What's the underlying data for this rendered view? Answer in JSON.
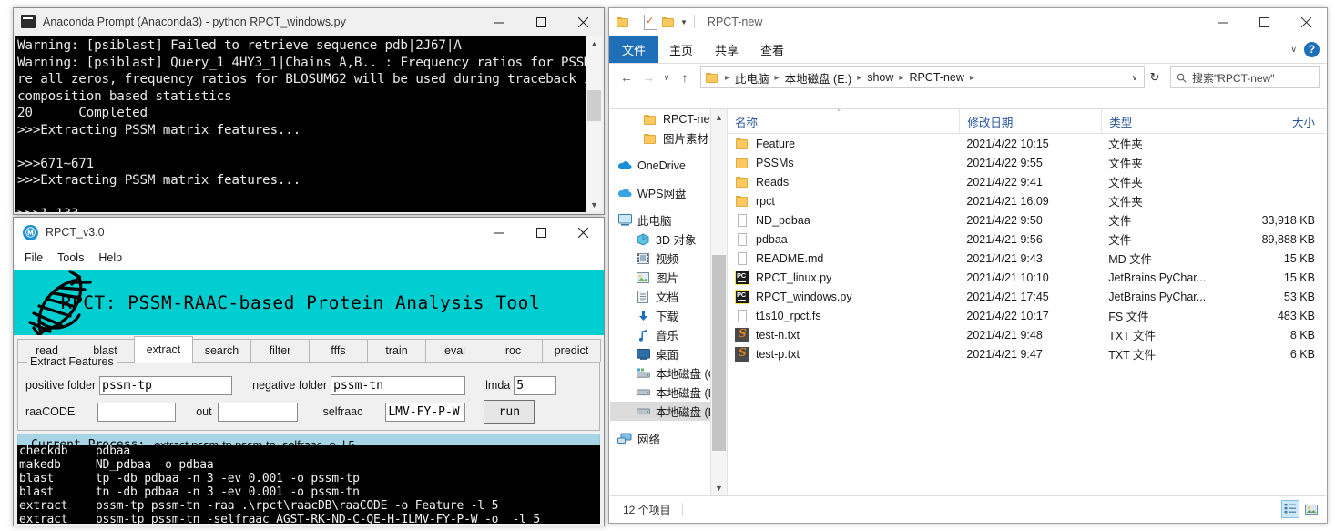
{
  "console_window": {
    "title": "Anaconda Prompt (Anaconda3) - python  RPCT_windows.py",
    "icon": "cmd-icon",
    "buttons": {
      "minimize": "─",
      "maximize": "☐",
      "close": "✕"
    },
    "text": "Warning: [psiblast] Failed to retrieve sequence pdb|2J67|A\nWarning: [psiblast] Query_1 4HY3_1|Chains A,B.. : Frequency ratios for PSSM a\nre all zeros, frequency ratios for BLOSUM62 will be used during traceback in\ncomposition based statistics\n20      Completed\n>>>Extracting PSSM matrix features...\n\n>>>671~671\n>>>Extracting PSSM matrix features...\n\n>>>1~133"
  },
  "rpct_window": {
    "title": "RPCT_v3.0",
    "icon": "rpct-logo-icon",
    "buttons": {
      "minimize": "─",
      "maximize": "☐",
      "close": "✕"
    },
    "menu": [
      "File",
      "Tools",
      "Help"
    ],
    "banner": {
      "title": "RPCT: PSSM-RAAC-based Protein Analysis Tool",
      "color": "#00ced1",
      "logo": "dna-helix-icon"
    },
    "tabs": [
      {
        "label": "read",
        "active": false
      },
      {
        "label": "blast",
        "active": false
      },
      {
        "label": "extract",
        "active": true
      },
      {
        "label": "search",
        "active": false
      },
      {
        "label": "filter",
        "active": false
      },
      {
        "label": "fffs",
        "active": false
      },
      {
        "label": "train",
        "active": false
      },
      {
        "label": "eval",
        "active": false
      },
      {
        "label": "roc",
        "active": false
      },
      {
        "label": "predict",
        "active": false
      }
    ],
    "panel": {
      "legend": "Extract Features",
      "fields": {
        "positive_folder_label": "positive folder",
        "positive_folder_value": "pssm-tp",
        "negative_folder_label": "negative folder",
        "negative_folder_value": "pssm-tn",
        "lmda_label": "lmda",
        "lmda_value": "5",
        "raacode_label": "raaCODE",
        "raacode_value": "",
        "out_label": "out",
        "out_value": "",
        "selfraac_label": "selfraac",
        "selfraac_value": "LMV-FY-P-W"
      },
      "run_button": "run"
    },
    "process_bar": {
      "label": "Current Process:",
      "command": "extract  pssm-tp pssm-tn -selfraac  -o  -l 5",
      "color": "#a8d5e5"
    },
    "console_text": "checkdb    pdbaa\nmakedb     ND_pdbaa -o pdbaa\nblast      tp -db pdbaa -n 3 -ev 0.001 -o pssm-tp\nblast      tn -db pdbaa -n 3 -ev 0.001 -o pssm-tn\nextract    pssm-tp pssm-tn -raa .\\rpct\\raacDB\\raaCODE -o Feature -l 5\nextract    pssm-tp pssm-tn -selfraac AGST-RK-ND-C-QE-H-ILMV-FY-P-W -o  -l 5"
  },
  "explorer_window": {
    "title": "RPCT-new",
    "quick_access": [
      "folder-icon",
      "properties-icon",
      "new-folder-icon",
      "customize-caret-icon"
    ],
    "buttons": {
      "minimize": "─",
      "maximize": "☐",
      "close": "✕"
    },
    "ribbon_tabs": [
      {
        "label": "文件",
        "active": true
      },
      {
        "label": "主页",
        "active": false
      },
      {
        "label": "共享",
        "active": false
      },
      {
        "label": "查看",
        "active": false
      }
    ],
    "ribbon_right": {
      "caret": "∨",
      "help": "?"
    },
    "nav": {
      "back": "←",
      "forward": "→",
      "recent": "∨",
      "up": "↑",
      "breadcrumb": [
        "此电脑",
        "本地磁盘 (E:)",
        "show",
        "RPCT-new"
      ],
      "address_caret": "∨",
      "refresh": "↻",
      "search_placeholder": "搜索\"RPCT-new\"",
      "search_icon": "search-icon"
    },
    "sidebar": [
      {
        "label": "RPCT-new",
        "icon": "folder-icon",
        "indent": 1,
        "selected": false
      },
      {
        "label": "图片素材",
        "icon": "folder-icon",
        "indent": 1,
        "selected": false
      },
      {
        "label": "OneDrive",
        "icon": "onedrive-icon",
        "indent": 0,
        "selected": false,
        "gap_before": true
      },
      {
        "label": "WPS网盘",
        "icon": "wps-cloud-icon",
        "indent": 0,
        "selected": false,
        "gap_before": true
      },
      {
        "label": "此电脑",
        "icon": "this-pc-icon",
        "indent": 0,
        "selected": false,
        "gap_before": true
      },
      {
        "label": "3D 对象",
        "icon": "3d-objects-icon",
        "indent": 1,
        "selected": false
      },
      {
        "label": "视频",
        "icon": "videos-icon",
        "indent": 1,
        "selected": false
      },
      {
        "label": "图片",
        "icon": "pictures-icon",
        "indent": 1,
        "selected": false
      },
      {
        "label": "文档",
        "icon": "documents-icon",
        "indent": 1,
        "selected": false
      },
      {
        "label": "下载",
        "icon": "downloads-icon",
        "indent": 1,
        "selected": false
      },
      {
        "label": "音乐",
        "icon": "music-icon",
        "indent": 1,
        "selected": false
      },
      {
        "label": "桌面",
        "icon": "desktop-icon",
        "indent": 1,
        "selected": false
      },
      {
        "label": "本地磁盘 (C:)",
        "icon": "system-drive-icon",
        "indent": 1,
        "selected": false
      },
      {
        "label": "本地磁盘 (D:)",
        "icon": "drive-icon",
        "indent": 1,
        "selected": false
      },
      {
        "label": "本地磁盘 (E:)",
        "icon": "drive-icon",
        "indent": 1,
        "selected": true
      },
      {
        "label": "网络",
        "icon": "network-icon",
        "indent": 0,
        "selected": false,
        "gap_before": true
      }
    ],
    "columns": [
      "名称",
      "修改日期",
      "类型",
      "大小"
    ],
    "sort_indicator": "∧",
    "files": [
      {
        "name": "Feature",
        "date": "2021/4/22 10:15",
        "type": "文件夹",
        "size": "",
        "icon": "folder-icon"
      },
      {
        "name": "PSSMs",
        "date": "2021/4/22 9:55",
        "type": "文件夹",
        "size": "",
        "icon": "folder-icon"
      },
      {
        "name": "Reads",
        "date": "2021/4/22 9:41",
        "type": "文件夹",
        "size": "",
        "icon": "folder-icon"
      },
      {
        "name": "rpct",
        "date": "2021/4/21 16:09",
        "type": "文件夹",
        "size": "",
        "icon": "folder-icon"
      },
      {
        "name": "ND_pdbaa",
        "date": "2021/4/22 9:50",
        "type": "文件",
        "size": "33,918 KB",
        "icon": "generic-file-icon"
      },
      {
        "name": "pdbaa",
        "date": "2021/4/21 9:56",
        "type": "文件",
        "size": "89,888 KB",
        "icon": "generic-file-icon"
      },
      {
        "name": "README.md",
        "date": "2021/4/21 9:43",
        "type": "MD 文件",
        "size": "15 KB",
        "icon": "generic-file-icon"
      },
      {
        "name": "RPCT_linux.py",
        "date": "2021/4/21 10:10",
        "type": "JetBrains PyChar...",
        "size": "15 KB",
        "icon": "pycharm-icon"
      },
      {
        "name": "RPCT_windows.py",
        "date": "2021/4/21 17:45",
        "type": "JetBrains PyChar...",
        "size": "53 KB",
        "icon": "pycharm-icon"
      },
      {
        "name": "t1s10_rpct.fs",
        "date": "2021/4/22 10:17",
        "type": "FS 文件",
        "size": "483 KB",
        "icon": "generic-file-icon"
      },
      {
        "name": "test-n.txt",
        "date": "2021/4/21 9:48",
        "type": "TXT 文件",
        "size": "8 KB",
        "icon": "sublime-icon"
      },
      {
        "name": "test-p.txt",
        "date": "2021/4/21 9:47",
        "type": "TXT 文件",
        "size": "6 KB",
        "icon": "sublime-icon"
      }
    ],
    "status": {
      "item_count": "12 个项目"
    },
    "view_buttons": [
      "details-view-icon",
      "large-icons-view-icon"
    ]
  }
}
